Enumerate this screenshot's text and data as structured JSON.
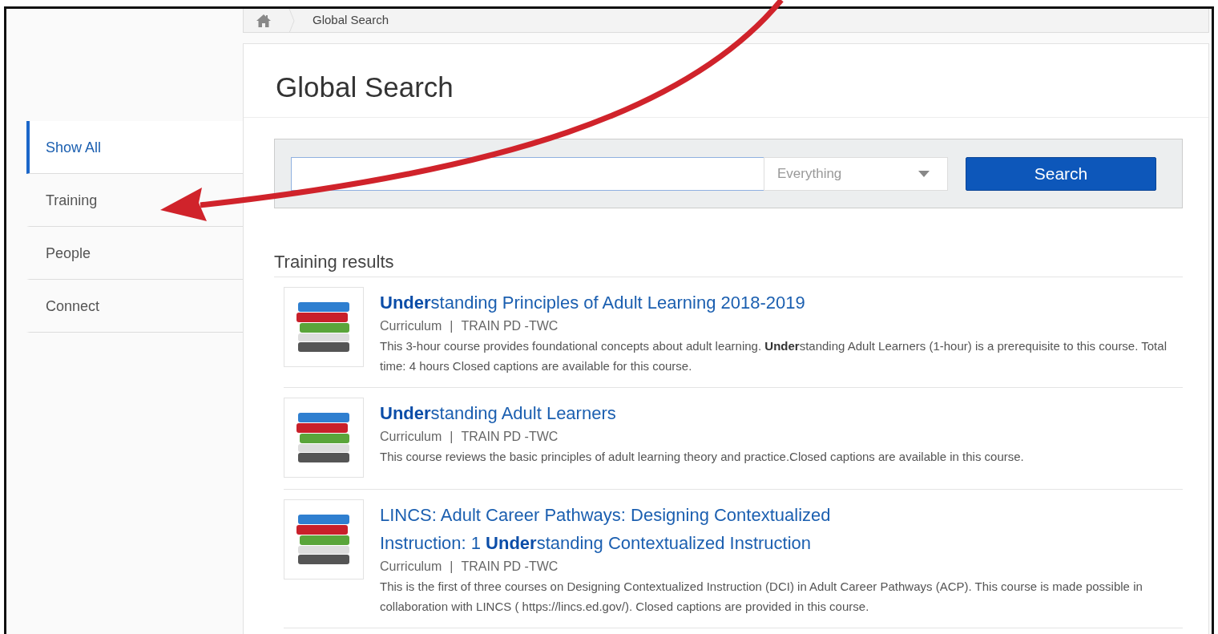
{
  "breadcrumb": {
    "items": [
      {
        "label": "Global Search"
      }
    ]
  },
  "sidebar": {
    "items": [
      {
        "label": "Show All",
        "selected": true
      },
      {
        "label": "Training",
        "selected": false
      },
      {
        "label": "People",
        "selected": false
      },
      {
        "label": "Connect",
        "selected": false
      }
    ]
  },
  "page_title": "Global Search",
  "search": {
    "scope": "Everything",
    "button": "Search"
  },
  "results_heading": "Training results",
  "results": [
    {
      "title": "**Under**standing Principles of Adult Learning 2018-2019",
      "type": "Curriculum",
      "separator": "|",
      "provider": "TRAIN PD -TWC",
      "description": "This 3-hour course provides foundational concepts about adult learning.  **Under**standing Adult Learners (1-hour) is a prerequisite to this course.  Total time: 4 hours Closed captions are available for this course."
    },
    {
      "title": "**Under**standing Adult Learners",
      "type": "Curriculum",
      "separator": "|",
      "provider": "TRAIN PD -TWC",
      "description": "This course reviews the basic principles of adult learning theory and practice.Closed captions are available in this course."
    },
    {
      "title": "LINCS: Adult Career Pathways: Designing Contextualized Instruction: 1 **Under**standing Contextualized Instruction",
      "type": "Curriculum",
      "separator": "|",
      "provider": "TRAIN PD -TWC",
      "description": "This is the first of three courses on Designing Contextualized Instruction (DCI) in Adult Career Pathways (ACP).  This course is made possible in collaboration with LINCS ( https://lincs.ed.gov/).  Closed captions are provided in this course."
    }
  ],
  "annotation": {
    "kind": "arrow",
    "color": "#d0232b"
  }
}
